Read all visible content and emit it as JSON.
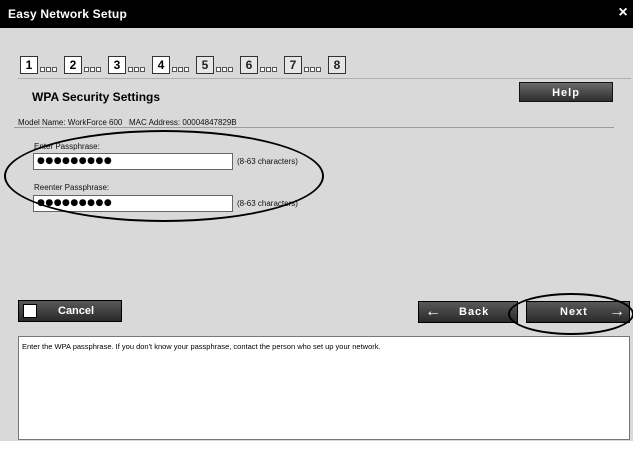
{
  "window": {
    "title": "Easy Network Setup",
    "close_glyph": "×"
  },
  "steps": [
    {
      "number": "1"
    },
    {
      "number": "2"
    },
    {
      "number": "3"
    },
    {
      "number": "4"
    },
    {
      "number": "5"
    },
    {
      "number": "6"
    },
    {
      "number": "7"
    },
    {
      "number": "8"
    }
  ],
  "main": {
    "title": "WPA Security Settings",
    "help_label": "Help",
    "model_name_label": "Model Name: WorkForce 600",
    "mac_address_label": "MAC Address: 00004847829B",
    "passphrase": {
      "label": "Enter Passphrase:",
      "value": "●●●●●●●●●",
      "hint": "(8-63 characters)"
    },
    "reenter_passphrase": {
      "label": "Reenter Passphrase:",
      "value": "●●●●●●●●●",
      "hint": "(8-63 characters)"
    }
  },
  "nav": {
    "cancel_label": "Cancel",
    "back_label": "Back",
    "next_label": "Next",
    "back_arrow": "←",
    "next_arrow": "→"
  },
  "message": {
    "text": "Enter the WPA passphrase. If you don't know your passphrase, contact the person who set up your network."
  },
  "colors": {
    "window_background": "#d9d9d9",
    "titlebar": "#000000",
    "button_dark": "#3a3a3a"
  }
}
